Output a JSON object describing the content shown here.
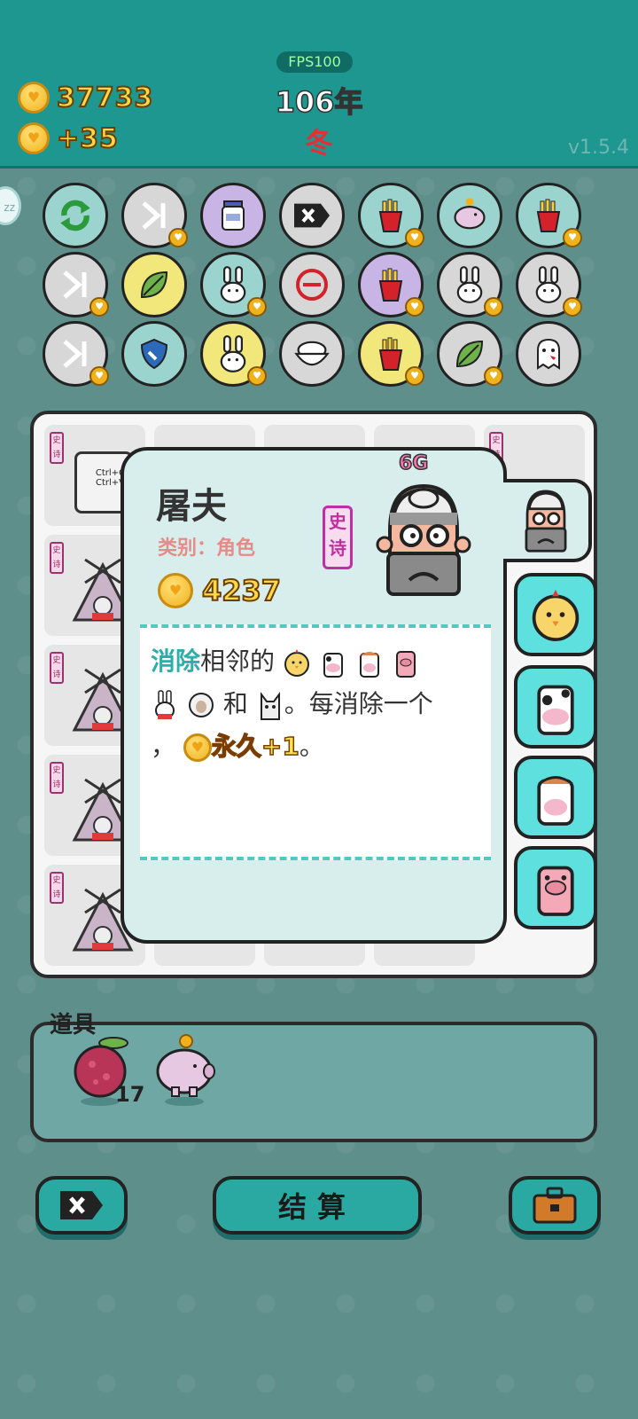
{
  "header": {
    "fps": "FPS100",
    "coins": "37733",
    "income": "+35",
    "year": "106年",
    "season": "冬",
    "version": "v1.5.4",
    "side_badge": "zz"
  },
  "items": [
    {
      "icon": "refresh-icon",
      "bg": "#9bd3ce"
    },
    {
      "icon": "skip-icon",
      "bg": "#d7d7d7"
    },
    {
      "icon": "jar-icon",
      "bg": "#c9b4e6"
    },
    {
      "icon": "delete-icon",
      "bg": "#d7d7d7"
    },
    {
      "icon": "fries-icon",
      "bg": "#9bd3ce"
    },
    {
      "icon": "piggy-bank-icon",
      "bg": "#9bd3ce"
    },
    {
      "icon": "fries-icon",
      "bg": "#9bd3ce"
    },
    {
      "icon": "skip-icon",
      "bg": "#d7d7d7"
    },
    {
      "icon": "leaf-icon",
      "bg": "#f2e77a"
    },
    {
      "icon": "rabbit-icon",
      "bg": "#9bd3ce"
    },
    {
      "icon": "no-entry-icon",
      "bg": "#d7d7d7"
    },
    {
      "icon": "fries-icon",
      "bg": "#c9b4e6"
    },
    {
      "icon": "rabbit-icon",
      "bg": "#d7d7d7"
    },
    {
      "icon": "rabbit-icon",
      "bg": "#d7d7d7"
    },
    {
      "icon": "skip-icon",
      "bg": "#d7d7d7"
    },
    {
      "icon": "shield-icon",
      "bg": "#9bd3ce"
    },
    {
      "icon": "rabbit-icon",
      "bg": "#f2e77a"
    },
    {
      "icon": "rice-bowl-icon",
      "bg": "#d7d7d7"
    },
    {
      "icon": "fries-icon",
      "bg": "#f2e77a"
    },
    {
      "icon": "leaf-icon",
      "bg": "#d7d7d7"
    },
    {
      "icon": "ghost-icon",
      "bg": "#d7d7d7"
    }
  ],
  "board": {
    "epic_label": "史诗",
    "keyboard_text": "Ctrl+C\nCtrl+V"
  },
  "popup": {
    "title": "屠夫",
    "category": "类别：角色",
    "price": "4237",
    "rarity": "史诗",
    "gen": "6G",
    "desc_keyword": "消除",
    "desc_part1": "相邻的",
    "desc_part2": "和",
    "desc_part3": "。每消除一个",
    "desc_part4": "，",
    "desc_bonus": "永久+1",
    "desc_end": "。"
  },
  "side_tabs": [
    "butcher-icon",
    "chick-icon",
    "cow-icon",
    "horse-icon",
    "pig-icon"
  ],
  "props": {
    "label": "道具",
    "items": [
      {
        "icon": "lychee-icon",
        "count": "17"
      },
      {
        "icon": "piggy-bank-icon",
        "count": ""
      }
    ]
  },
  "buttons": {
    "settle": "结算"
  },
  "colors": {
    "header": "#1e9790",
    "accent": "#2aa9a3",
    "coin": "#f0b21c",
    "epic": "#c02fa2"
  }
}
